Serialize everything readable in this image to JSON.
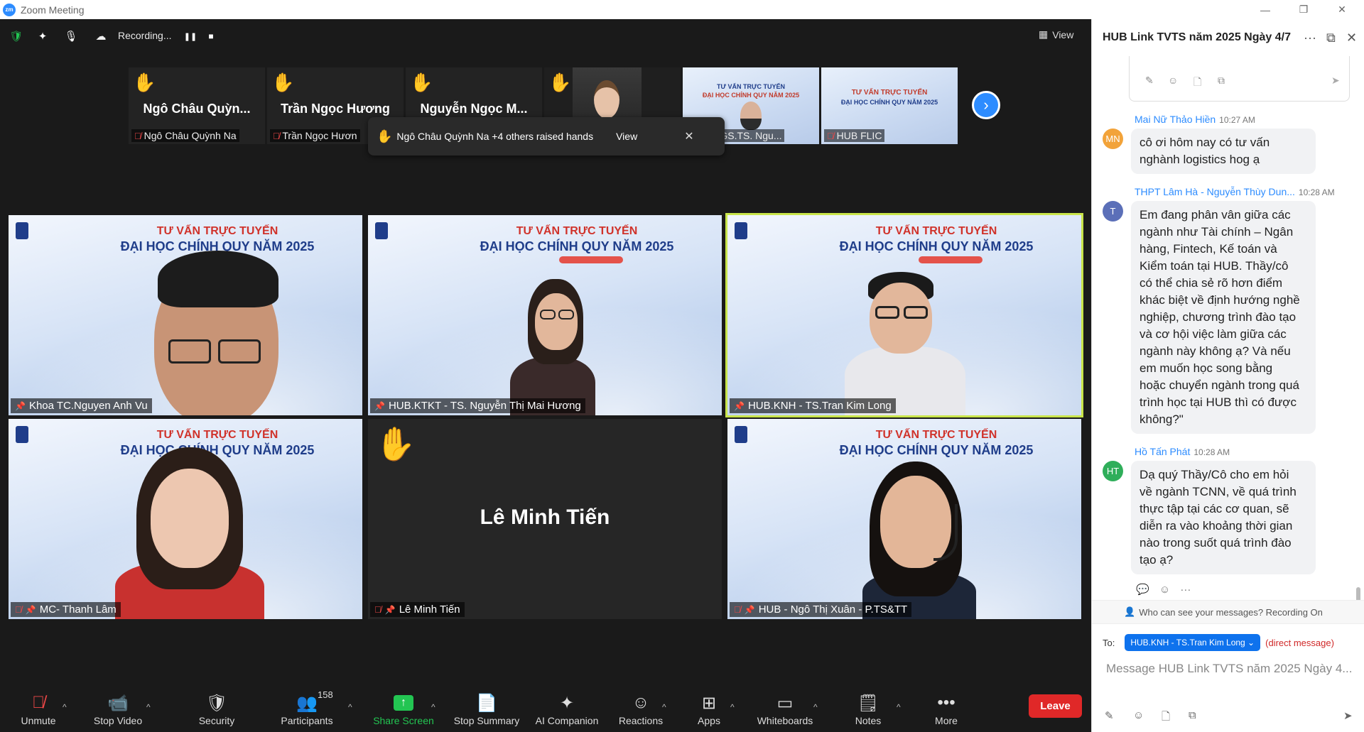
{
  "window": {
    "title": "Zoom Meeting",
    "logo": "zm",
    "minimize": "—",
    "restore": "❐",
    "close": "✕"
  },
  "topbar": {
    "shield_icon": "🛡",
    "sparkle_icon": "✦",
    "mic_icon": "🎙",
    "recording_label": "Recording...",
    "pause_icon": "❚❚",
    "stop_icon": "■",
    "view_icon": "▦",
    "view_label": "View"
  },
  "filmstrip": [
    {
      "name": "Ngô Châu Quỳn...",
      "label": "Ngô Châu Quỳnh Na",
      "hand": "✋"
    },
    {
      "name": "Trần Ngọc Hương",
      "label": "Trần Ngọc Hươn",
      "hand": "✋"
    },
    {
      "name": "Nguyễn Ngọc M...",
      "label": "",
      "hand": "✋"
    },
    {
      "label": "",
      "hand": "✋"
    },
    {
      "label": "STS, PGS.TS. Ngu...",
      "slide_title": "TƯ VẤN TRỰC TUYẾN",
      "slide_sub": "ĐẠI HỌC CHÍNH QUY NĂM 2025"
    },
    {
      "label": "HUB FLIC",
      "slide_title": "TƯ VẤN TRỰC TUYẾN",
      "slide_sub": "ĐẠI HỌC CHÍNH QUY NĂM 2025"
    }
  ],
  "next_icon": "›",
  "toast": {
    "hand": "✋",
    "text": "Ngô Châu Quỳnh Na +4 others raised hands",
    "view": "View",
    "close": "✕"
  },
  "slide": {
    "title": "TƯ VẤN TRỰC TUYẾN",
    "subtitle": "ĐẠI HỌC CHÍNH QUY NĂM 2025"
  },
  "tiles": [
    {
      "label": "Khoa TC.Nguyen Anh Vu"
    },
    {
      "label": "HUB.KTKT - TS. Nguyễn Thị Mai Hương"
    },
    {
      "label": "HUB.KNH - TS.Tran Kim Long"
    },
    {
      "label": "MC- Thanh Lâm"
    },
    {
      "label": "Lê Minh Tiến",
      "name": "Lê Minh Tiến",
      "hand": "✋"
    },
    {
      "label": "HUB - Ngô Thị Xuân - P.TS&TT"
    }
  ],
  "toolbar": {
    "unmute": "Unmute",
    "stop_video": "Stop Video",
    "security": "Security",
    "participants": "Participants",
    "participant_count": "158",
    "share_screen": "Share Screen",
    "stop_summary": "Stop Summary",
    "ai_companion": "AI Companion",
    "reactions": "Reactions",
    "apps": "Apps",
    "whiteboards": "Whiteboards",
    "notes": "Notes",
    "more": "More",
    "leave": "Leave",
    "caret": "^"
  },
  "chat": {
    "title": "HUB Link TVTS năm 2025 Ngày 4/7",
    "more_icon": "···",
    "popout_icon": "⧉",
    "close_icon": "✕",
    "messages": [
      {
        "initials": "MN",
        "avatar_color": "#f2a33a",
        "sender": "Mai Nữ Thảo Hiền",
        "time": "10:27 AM",
        "lines": [
          "cô ơi hôm nay có tư vấn",
          "nghành logistics hog ạ"
        ]
      },
      {
        "initials": "T",
        "avatar_color": "#5b6fb8",
        "sender": "THPT Lâm Hà - Nguyễn Thùy Dun...",
        "time": "10:28 AM",
        "lines": [
          "Em đang phân vân giữa các",
          "ngành như Tài chính – Ngân",
          "hàng, Fintech, Kế toán và",
          "Kiểm toán tại HUB. Thầy/cô",
          "có thể chia sẻ rõ hơn điểm",
          "khác biệt về định hướng nghề",
          "nghiệp, chương trình đào tạo",
          "và cơ hội việc làm giữa các",
          "ngành này không ạ? Và nếu",
          "em muốn học song bằng",
          "hoặc chuyển ngành trong quá",
          "trình học tại HUB thì có được",
          "không?\""
        ]
      },
      {
        "initials": "HT",
        "avatar_color": "#2fae5a",
        "sender": "Hồ Tấn Phát",
        "time": "10:28 AM",
        "lines": [
          "Dạ quý Thầy/Cô cho em hỏi",
          "về ngành TCNN, về quá trình",
          "thực tập tại các cơ quan, sẽ",
          "diễn ra vào khoảng thời gian",
          "nào trong suốt quá trình đào",
          "tạo ạ?"
        ]
      }
    ],
    "privacy_text": "Who can see your messages? Recording On",
    "to_label": "To:",
    "to_recipient": "HUB.KNH - TS.Tran Kim Long ⌄",
    "direct_message": "(direct message)",
    "input_placeholder": "Message HUB Link TVTS năm 2025 Ngày 4..."
  }
}
